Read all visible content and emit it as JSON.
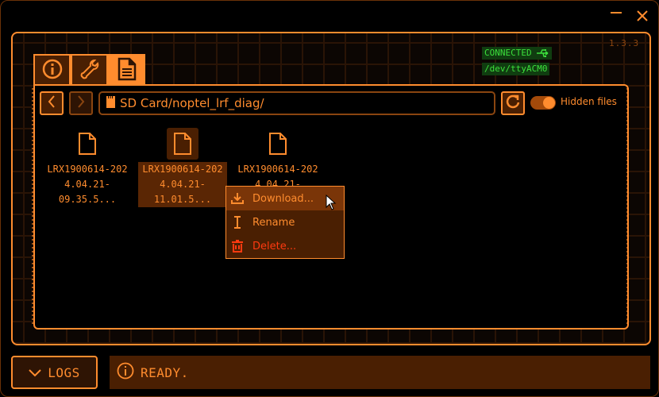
{
  "window": {
    "version": "1.3.3",
    "minimize_icon": "minimize-icon",
    "close_icon": "close-icon"
  },
  "connection": {
    "status": "CONNECTED",
    "status_icon": "usb-icon",
    "port": "/dev/ttyACM0",
    "status_color": "#3ce03c"
  },
  "tabs": [
    {
      "icon": "info-icon",
      "active": false
    },
    {
      "icon": "wrench-icon",
      "active": false
    },
    {
      "icon": "document-icon",
      "active": true
    }
  ],
  "toolbar": {
    "back_icon": "chevron-left-icon",
    "forward_icon": "chevron-right-icon",
    "path_icon": "sd-card-icon",
    "path": "SD Card/noptel_lrf_diag/",
    "refresh_icon": "refresh-icon",
    "hidden_files_label": "Hidden files",
    "hidden_files_on": true
  },
  "files": [
    {
      "line1": "LRX1900614-202",
      "line2": "4.04.21-09.35.5...",
      "selected": false
    },
    {
      "line1": "LRX1900614-202",
      "line2": "4.04.21-11.01.5...",
      "selected": true
    },
    {
      "line1": "LRX1900614-202",
      "line2": "4.04.21-11.02.1",
      "selected": false
    }
  ],
  "context_menu": {
    "items": [
      {
        "label": "Download...",
        "icon": "download-icon"
      },
      {
        "label": "Rename",
        "icon": "text-cursor-icon"
      },
      {
        "label": "Delete...",
        "icon": "trash-icon"
      }
    ]
  },
  "footer": {
    "logs_label": "LOGS",
    "logs_icon": "chevron-down-icon",
    "status_icon": "info-icon",
    "status_text": "READY."
  },
  "colors": {
    "accent": "#ff8c2e",
    "panel_dark": "#4a1f02",
    "danger": "#ff3a10"
  }
}
